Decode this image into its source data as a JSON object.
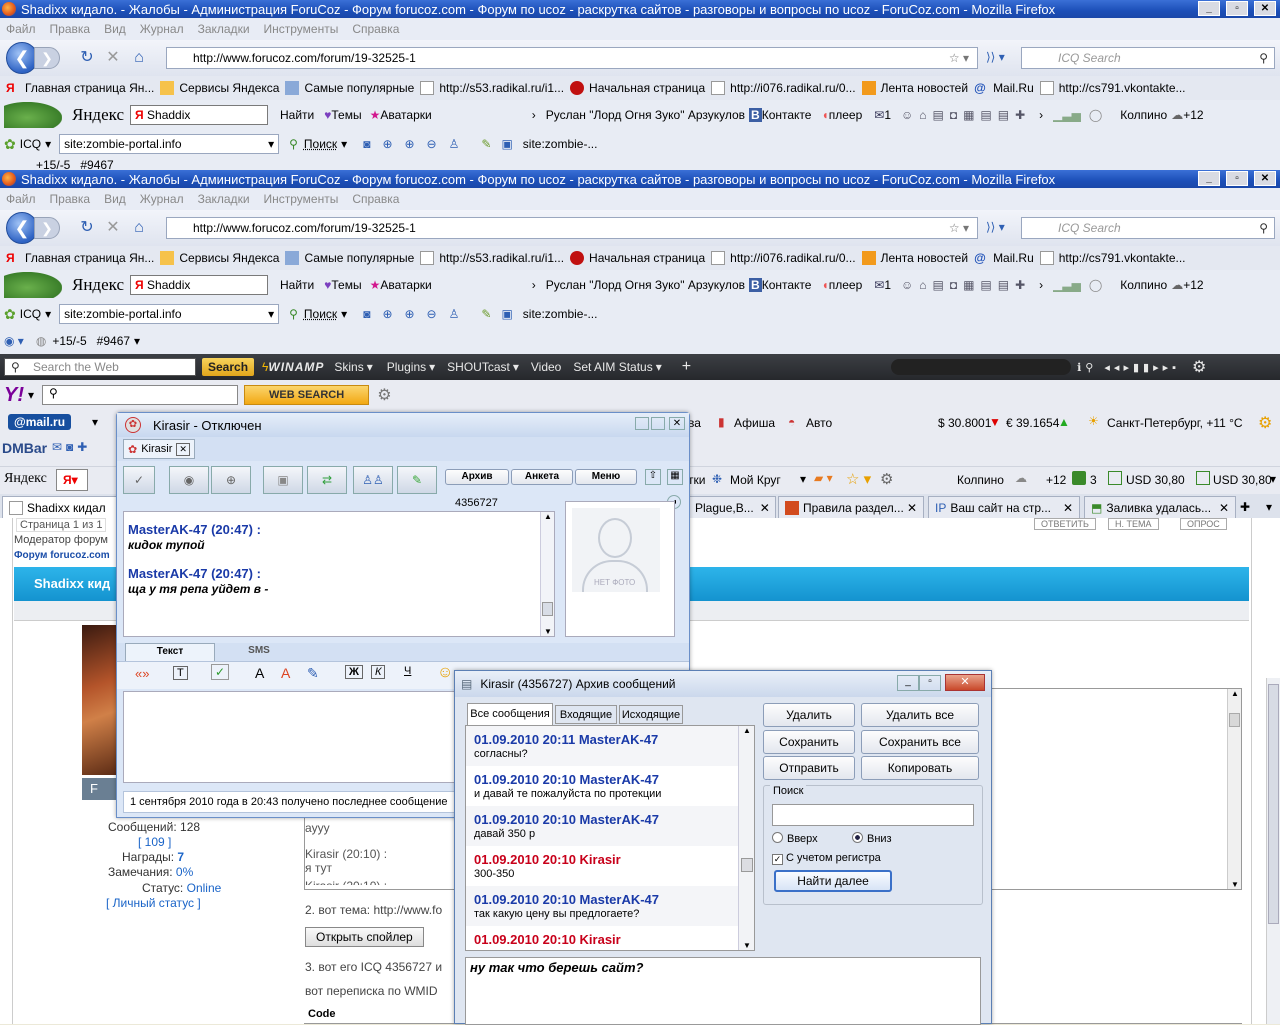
{
  "browser": {
    "title": "Shadixx кидало. - Жалобы - Администрация ForuCoz - Форум forucoz.com - Форум по ucoz - раскрутка сайтов - разговоры и вопросы по ucoz - ForuCoz.com - Mozilla Firefox",
    "menu": [
      "Файл",
      "Правка",
      "Вид",
      "Журнал",
      "Закладки",
      "Инструменты",
      "Справка"
    ],
    "url": "http://www.forucoz.com/forum/19-32525-1",
    "search_placeholder": "ICQ Search",
    "bookmarks": [
      "Главная страница Ян...",
      "Сервисы Яндекса",
      "Самые популярные",
      "http://s53.radikal.ru/i1...",
      "Начальная страница",
      "http://i076.radikal.ru/0...",
      "Лента новостей",
      "Mail.Ru",
      "http://cs791.vkontakte..."
    ],
    "yandex_bar": {
      "logo": "Яндекс",
      "query": "Shaddix",
      "find": "Найти",
      "themes": "Темы",
      "avatars": "Аватарки",
      "user": "Руслан \"Лорд Огня Зуко\" Арзукулов",
      "vk": "Контакте",
      "player": "плеер",
      "mail_count": "1",
      "weather": "Колпино",
      "temp": "+12"
    },
    "icq_bar": {
      "label": "ICQ",
      "site": "site:zombie-portal.info",
      "search": "Поиск",
      "site2": "site:zombie-..."
    },
    "counter_bar": {
      "score": "+15/-5",
      "num": "#9467"
    },
    "aol_bar": {
      "search_placeholder": "Search the Web",
      "search_btn": "Search",
      "winamp": "WINAMP",
      "skins": "Skins",
      "plugins": "Plugins",
      "shoutcast": "SHOUTcast",
      "video": "Video",
      "aim": "Set AIM Status"
    },
    "yahoo_bar": {
      "web_search": "WEB SEARCH"
    },
    "mail_bar": {
      "logo": "@mail.ru",
      "afisha": "Афиша",
      "auto": "Авто",
      "usd": "$ 30.8001",
      "eur": "€ 39.1654",
      "weather": "Санкт-Петербург, +11 °C",
      "va": "ва"
    },
    "dmbar": "DMBar",
    "yandex_bar2": {
      "logo": "Яндекс",
      "tki": "тки",
      "krug": "Мой Круг",
      "weather": "Колпино",
      "temp": "+12",
      "count": "3",
      "usd1": "USD 30,80",
      "usd2": "USD 30,80"
    },
    "tabs": [
      "Shadixx кидал",
      "Plague,B...",
      "Правила раздел...",
      "Ваш сайт на стр...",
      "Заливка удалась..."
    ]
  },
  "forum": {
    "page_info": "Страница 1 из 1",
    "moderator": "Модератор форум",
    "forum_link": "Форум forucoz.com",
    "heading": "Shadixx кид",
    "user_letter": "F",
    "stats": {
      "messages_label": "Сообщений:",
      "messages": "128",
      "messages_link": "[ 109 ]",
      "awards_label": "Награды:",
      "awards": "7",
      "warnings_label": "Замечания:",
      "warnings": "0%",
      "status_label": "Статус:",
      "status": "Online",
      "personal": "[ Личный статус ]"
    },
    "post_lines": [
      "ayyy",
      "Kirasir (20:10) :",
      "я тут",
      "Kirasir (20:10) :"
    ],
    "item2": "2. вот тема: http://www.fo",
    "spoiler": "Открыть спойлер",
    "item3": "3. вот его ICQ 4356727 и",
    "wmid": "вот переписка по WMID",
    "code": "Code",
    "top_buttons": [
      "ОТВЕТИТЬ",
      "Н. ТЕМА",
      "ОПРОС"
    ]
  },
  "chat": {
    "title": "Kirasir - Отключен",
    "tab": "Kirasir",
    "buttons": [
      "Архив",
      "Анкета",
      "Меню"
    ],
    "uin": "4356727",
    "messages": [
      {
        "sender": "MasterAK-47 (20:47) :",
        "text": "кидок тупой"
      },
      {
        "sender": "MasterAK-47 (20:47) :",
        "text": "ща у тя репа уйдет в -"
      }
    ],
    "no_photo": "НЕТ ФОТО",
    "input_tabs": [
      "Текст",
      "SMS"
    ],
    "format": {
      "bold": "Ж",
      "italic": "К",
      "underline": "Ч"
    },
    "status": "1 сентября 2010 года в 20:43 получено последнее сообщение"
  },
  "archive": {
    "title": "Kirasir (4356727) Архив сообщений",
    "tabs": [
      "Все сообщения",
      "Входящие",
      "Исходящие"
    ],
    "messages": [
      {
        "header": "01.09.2010 20:11 MasterAK-47",
        "text": "согласны?",
        "color": "blue"
      },
      {
        "header": "01.09.2010 20:10 MasterAK-47",
        "text": "и давай те пожалуйста по протекции",
        "color": "blue"
      },
      {
        "header": "01.09.2010 20:10 MasterAK-47",
        "text": "давай 350 р",
        "color": "blue"
      },
      {
        "header": "01.09.2010 20:10 Kirasir",
        "text": "300-350",
        "color": "red"
      },
      {
        "header": "01.09.2010 20:10 MasterAK-47",
        "text": "так какую цену вы предлогаете?",
        "color": "blue"
      },
      {
        "header": "01.09.2010 20:10 Kirasir",
        "text": "",
        "color": "red"
      }
    ],
    "buttons": {
      "delete": "Удалить",
      "delete_all": "Удалить все",
      "save": "Сохранить",
      "save_all": "Сохранить все",
      "send": "Отправить",
      "copy": "Копировать"
    },
    "search_label": "Поиск",
    "up": "Вверх",
    "down": "Вниз",
    "case": "С учетом регистра",
    "find_next": "Найти далее",
    "preview": "ну так что берешь сайт?"
  },
  "colors": {
    "title_blue": "#1c4fb8",
    "msg_blue": "#1a3aa8",
    "msg_red": "#c8001a",
    "forum_banner": "#17a6df",
    "online_link": "#1a64c8"
  }
}
